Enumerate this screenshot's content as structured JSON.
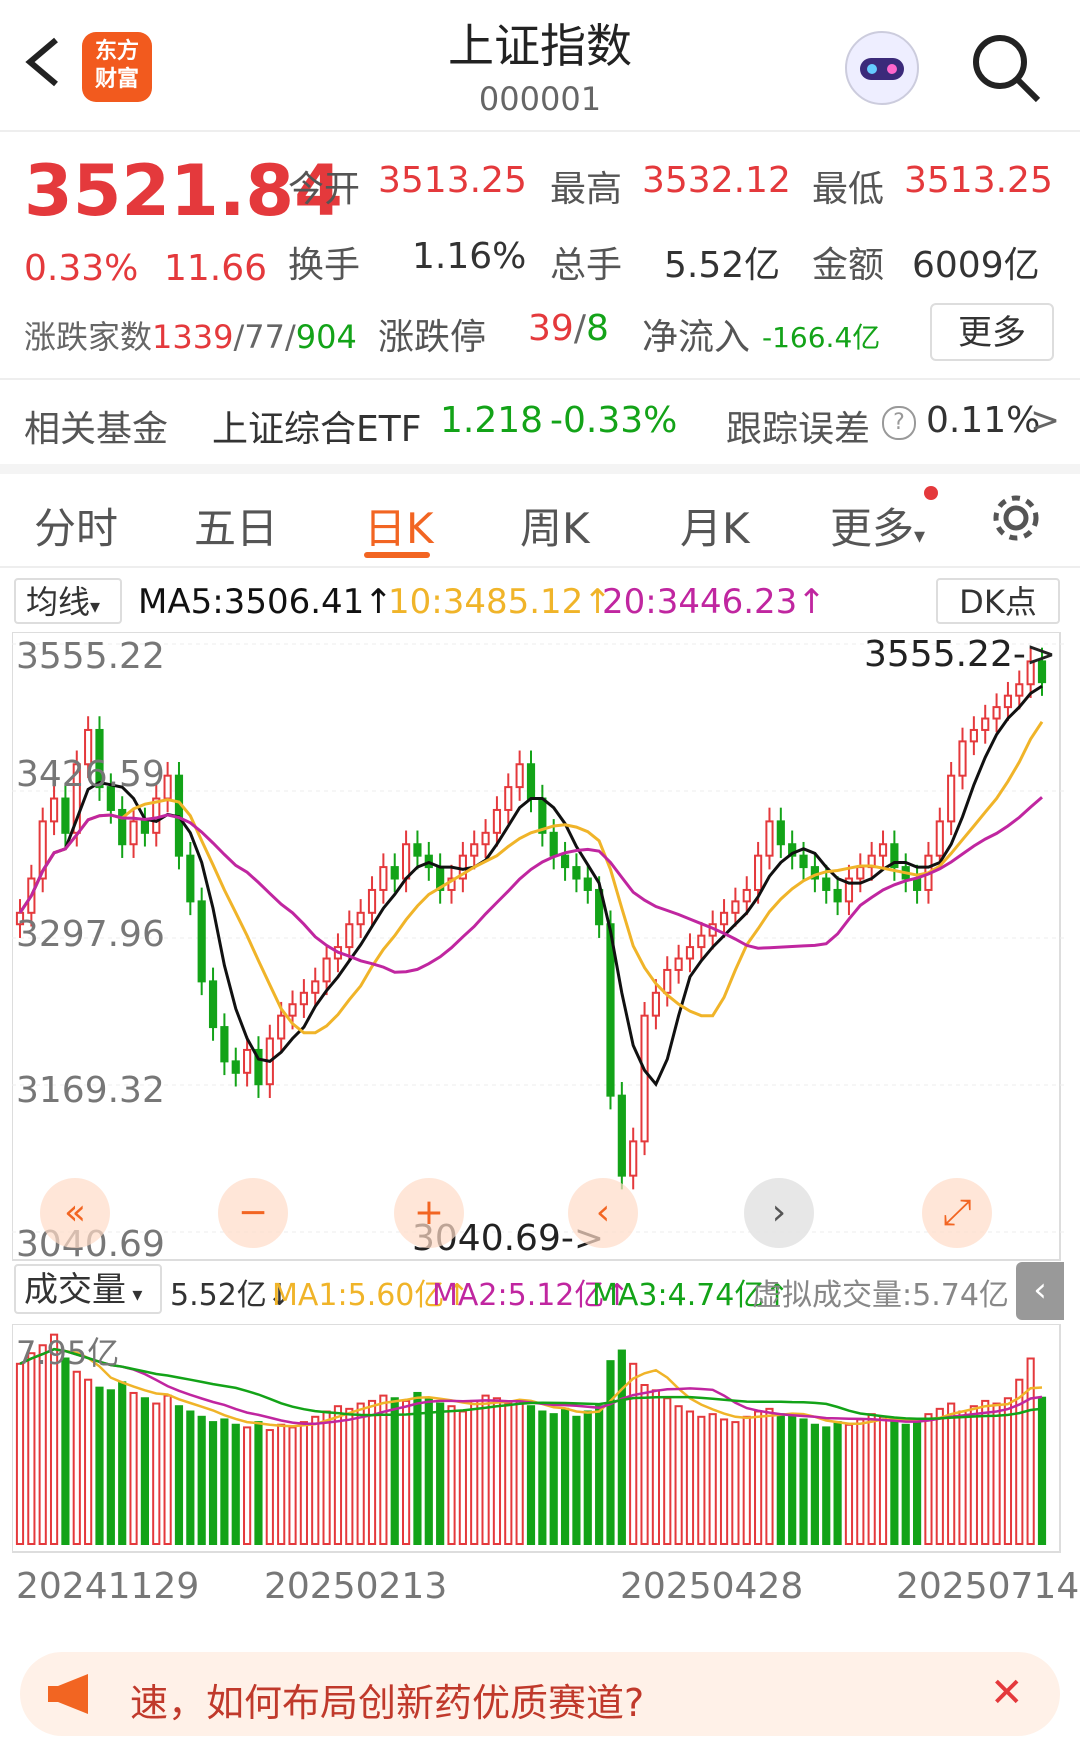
{
  "header": {
    "title": "上证指数",
    "code": "000001",
    "logo_text_1": "东方",
    "logo_text_2": "财富",
    "back_icon": "chevron-left-icon",
    "search_icon": "search-icon",
    "robot_icon": "robot-avatar-icon"
  },
  "quote": {
    "price": "3521.84",
    "change_pct": "0.33%",
    "change": "11.66",
    "open_label": "今开",
    "open": "3513.25",
    "high_label": "最高",
    "high": "3532.12",
    "low_label": "最低",
    "low": "3513.25",
    "turnover_label": "换手",
    "turnover": "1.16%",
    "volume_label": "总手",
    "volume": "5.52亿",
    "amount_label": "金额",
    "amount": "6009亿",
    "breadth_label": "涨跌家数",
    "breadth_up": "1339",
    "breadth_flat": "77",
    "breadth_down": "904",
    "slash": "/",
    "limit_label": "涨跌停",
    "limit_up": "39",
    "limit_down": "8",
    "netflow_label": "净流入",
    "netflow": "-166.4亿",
    "more_label": "更多"
  },
  "fund": {
    "label": "相关基金",
    "name": "上证综合ETF",
    "price": "1.218",
    "change": "-0.33%",
    "tracking_label": "跟踪误差",
    "tracking": "0.11%",
    "arrow": ">"
  },
  "tabs": [
    "分时",
    "五日",
    "日K",
    "周K",
    "月K",
    "更多"
  ],
  "active_tab": 2,
  "ma_bar": {
    "selector": "均线",
    "ma5": "MA5:3506.41↑",
    "ma10": "10:3485.12↑",
    "ma20": "20:3446.23↑",
    "dk": "DK点"
  },
  "colors": {
    "up": "#e4393c",
    "down": "#13a318",
    "ma5": "#111111",
    "ma10": "#f0b429",
    "ma20": "#c026a0",
    "accent": "#f26522"
  },
  "price_axis": [
    "3555.22",
    "3426.59",
    "3297.96",
    "3169.32",
    "3040.69"
  ],
  "high_marker": "3555.22->",
  "low_marker": "3040.69->",
  "chart_controls": [
    "«",
    "−",
    "+",
    "‹",
    "›",
    "⤢"
  ],
  "watermark": "东方财富",
  "vol_bar": {
    "selector": "成交量",
    "value": "5.52亿↓",
    "ma1": "MA1:5.60亿↑",
    "ma2": "MA2:5.12亿↑",
    "ma3": "MA3:4.74亿↑",
    "virtual": "虚拟成交量:5.74亿",
    "vol_axis_max": "7.95亿"
  },
  "dates": [
    "20241129",
    "20250213",
    "20250428",
    "20250714"
  ],
  "banner": {
    "text": "速，如何布局创新药优质赛道?",
    "close": "✕"
  },
  "chart_data": {
    "type": "candlestick",
    "title": "上证指数",
    "ylim": [
      3040.69,
      3555.22
    ],
    "y_ticks": [
      3555.22,
      3426.59,
      3297.96,
      3169.32,
      3040.69
    ],
    "x_ticks": [
      "20241129",
      "20250213",
      "20250428",
      "20250714"
    ],
    "close_series": [
      3320,
      3350,
      3400,
      3420,
      3390,
      3450,
      3480,
      3430,
      3410,
      3380,
      3400,
      3390,
      3420,
      3440,
      3370,
      3330,
      3260,
      3220,
      3190,
      3180,
      3200,
      3170,
      3210,
      3230,
      3240,
      3250,
      3260,
      3280,
      3290,
      3310,
      3320,
      3340,
      3360,
      3350,
      3380,
      3370,
      3360,
      3340,
      3350,
      3370,
      3380,
      3390,
      3410,
      3430,
      3450,
      3420,
      3390,
      3370,
      3360,
      3350,
      3340,
      3310,
      3160,
      3090,
      3120,
      3230,
      3250,
      3270,
      3280,
      3290,
      3300,
      3310,
      3320,
      3330,
      3340,
      3370,
      3400,
      3380,
      3370,
      3360,
      3350,
      3340,
      3330,
      3350,
      3360,
      3370,
      3380,
      3360,
      3350,
      3340,
      3370,
      3400,
      3440,
      3470,
      3480,
      3490,
      3500,
      3510,
      3520,
      3540,
      3521.84
    ],
    "ma_lines": {
      "MA5": "3506.41",
      "MA10": "3485.12",
      "MA20": "3446.23"
    },
    "volume_series": [
      6.8,
      7.2,
      7.5,
      7.9,
      7.0,
      6.5,
      6.2,
      5.9,
      5.8,
      6.1,
      5.7,
      5.5,
      5.3,
      5.6,
      5.2,
      5.0,
      4.8,
      4.6,
      4.7,
      4.5,
      4.4,
      4.6,
      4.3,
      4.5,
      4.4,
      4.6,
      4.8,
      5.0,
      5.2,
      5.1,
      5.3,
      5.4,
      5.6,
      5.5,
      5.4,
      5.7,
      5.5,
      5.3,
      5.2,
      5.0,
      5.4,
      5.6,
      5.5,
      5.3,
      5.4,
      5.2,
      5.0,
      4.9,
      5.1,
      4.8,
      5.0,
      5.2,
      6.9,
      7.3,
      6.8,
      6.0,
      5.8,
      5.5,
      5.2,
      5.0,
      4.8,
      4.9,
      4.7,
      4.6,
      4.8,
      5.0,
      5.1,
      4.9,
      4.8,
      4.7,
      4.5,
      4.4,
      4.6,
      4.5,
      4.7,
      4.9,
      4.8,
      4.6,
      4.5,
      4.7,
      4.9,
      5.1,
      5.3,
      5.0,
      5.2,
      5.4,
      5.3,
      5.5,
      6.2,
      7.0,
      5.52
    ]
  }
}
